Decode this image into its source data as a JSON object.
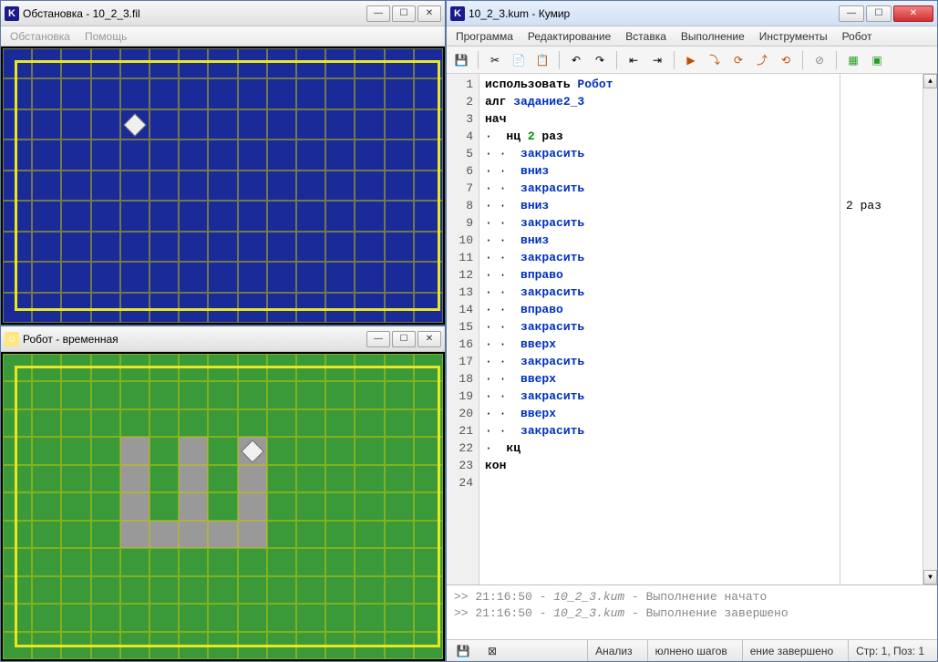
{
  "windows": {
    "env": {
      "title": "Обстановка - 10_2_3.fil",
      "menu": [
        "Обстановка",
        "Помощь"
      ],
      "icon": "K"
    },
    "robot": {
      "title": "Робот - временная",
      "icon": "☺"
    },
    "kumir": {
      "title": "10_2_3.kum - Кумир",
      "icon": "K",
      "menu": [
        "Программа",
        "Редактирование",
        "Вставка",
        "Выполнение",
        "Инструменты",
        "Робот"
      ],
      "side_output": "2 раз",
      "status": {
        "analysis": "Анализ",
        "steps": "юлнено шагов",
        "done": "ение завершено",
        "cursor": "Стр: 1, Поз: 1"
      }
    }
  },
  "code": {
    "lines": [
      {
        "n": 1,
        "indent": 0,
        "tokens": [
          [
            "kw",
            "использовать "
          ],
          [
            "exec",
            "Робот"
          ]
        ]
      },
      {
        "n": 2,
        "indent": 0,
        "tokens": [
          [
            "kw",
            "алг "
          ],
          [
            "cmd",
            "задание2_3"
          ]
        ]
      },
      {
        "n": 3,
        "indent": 0,
        "tokens": [
          [
            "kw",
            "нач"
          ]
        ]
      },
      {
        "n": 4,
        "indent": 1,
        "marker": "·",
        "tokens": [
          [
            "kw",
            "нц "
          ],
          [
            "num",
            "2"
          ],
          [
            "kw",
            " раз"
          ]
        ]
      },
      {
        "n": 5,
        "indent": 2,
        "marker": "· ·",
        "tokens": [
          [
            "cmd",
            "закрасить"
          ]
        ]
      },
      {
        "n": 6,
        "indent": 2,
        "marker": "· ·",
        "tokens": [
          [
            "cmd",
            "вниз"
          ]
        ]
      },
      {
        "n": 7,
        "indent": 2,
        "marker": "· ·",
        "tokens": [
          [
            "cmd",
            "закрасить"
          ]
        ]
      },
      {
        "n": 8,
        "indent": 2,
        "marker": "· ·",
        "tokens": [
          [
            "cmd",
            "вниз"
          ]
        ]
      },
      {
        "n": 9,
        "indent": 2,
        "marker": "· ·",
        "tokens": [
          [
            "cmd",
            "закрасить"
          ]
        ]
      },
      {
        "n": 10,
        "indent": 2,
        "marker": "· ·",
        "tokens": [
          [
            "cmd",
            "вниз"
          ]
        ]
      },
      {
        "n": 11,
        "indent": 2,
        "marker": "· ·",
        "tokens": [
          [
            "cmd",
            "закрасить"
          ]
        ]
      },
      {
        "n": 12,
        "indent": 2,
        "marker": "· ·",
        "tokens": [
          [
            "cmd",
            "вправо"
          ]
        ]
      },
      {
        "n": 13,
        "indent": 2,
        "marker": "· ·",
        "tokens": [
          [
            "cmd",
            "закрасить"
          ]
        ]
      },
      {
        "n": 14,
        "indent": 2,
        "marker": "· ·",
        "tokens": [
          [
            "cmd",
            "вправо"
          ]
        ]
      },
      {
        "n": 15,
        "indent": 2,
        "marker": "· ·",
        "tokens": [
          [
            "cmd",
            "закрасить"
          ]
        ]
      },
      {
        "n": 16,
        "indent": 2,
        "marker": "· ·",
        "tokens": [
          [
            "cmd",
            "вверх"
          ]
        ]
      },
      {
        "n": 17,
        "indent": 2,
        "marker": "· ·",
        "tokens": [
          [
            "cmd",
            "закрасить"
          ]
        ]
      },
      {
        "n": 18,
        "indent": 2,
        "marker": "· ·",
        "tokens": [
          [
            "cmd",
            "вверх"
          ]
        ]
      },
      {
        "n": 19,
        "indent": 2,
        "marker": "· ·",
        "tokens": [
          [
            "cmd",
            "закрасить"
          ]
        ]
      },
      {
        "n": 20,
        "indent": 2,
        "marker": "· ·",
        "tokens": [
          [
            "cmd",
            "вверх"
          ]
        ]
      },
      {
        "n": 21,
        "indent": 2,
        "marker": "· ·",
        "tokens": [
          [
            "cmd",
            "закрасить"
          ]
        ]
      },
      {
        "n": 22,
        "indent": 1,
        "marker": "·",
        "tokens": [
          [
            "kw",
            "кц"
          ]
        ]
      },
      {
        "n": 23,
        "indent": 0,
        "tokens": [
          [
            "kw",
            "кон"
          ]
        ]
      },
      {
        "n": 24,
        "indent": 0,
        "tokens": []
      }
    ]
  },
  "console_lines": [
    ">> 21:16:50 - 10_2_3.kum - Выполнение начато",
    ">> 21:16:50 - 10_2_3.kum - Выполнение завершено"
  ],
  "toolbar_icons": [
    {
      "name": "save-icon",
      "glyph": "💾"
    },
    {
      "name": "cut-icon",
      "glyph": "✂"
    },
    {
      "name": "copy-icon",
      "glyph": "📄"
    },
    {
      "name": "paste-icon",
      "glyph": "📋"
    },
    {
      "name": "undo-icon",
      "glyph": "↶"
    },
    {
      "name": "redo-icon",
      "glyph": "↷"
    },
    {
      "name": "outdent-icon",
      "glyph": "⇤"
    },
    {
      "name": "indent-icon",
      "glyph": "⇥"
    },
    {
      "name": "run-icon",
      "glyph": "▶"
    },
    {
      "name": "step-icon",
      "glyph": "⤵"
    },
    {
      "name": "stepover-icon",
      "glyph": "⟳"
    },
    {
      "name": "stepout-icon",
      "glyph": "⤴"
    },
    {
      "name": "trace-icon",
      "glyph": "⟲"
    },
    {
      "name": "stop-icon",
      "glyph": "⊘"
    },
    {
      "name": "grid-icon",
      "glyph": "▦"
    },
    {
      "name": "robot-icon",
      "glyph": "▣"
    }
  ],
  "env_grid": {
    "cols": 15,
    "rows": 9,
    "robot": {
      "col": 4,
      "row": 2
    }
  },
  "robot_grid": {
    "cols": 15,
    "rows": 11,
    "robot": {
      "col": 8,
      "row": 3
    },
    "painted": [
      [
        4,
        3
      ],
      [
        4,
        4
      ],
      [
        4,
        5
      ],
      [
        4,
        6
      ],
      [
        5,
        6
      ],
      [
        6,
        6
      ],
      [
        6,
        5
      ],
      [
        6,
        4
      ],
      [
        6,
        3
      ],
      [
        7,
        6
      ],
      [
        8,
        6
      ],
      [
        8,
        5
      ],
      [
        8,
        4
      ],
      [
        8,
        3
      ]
    ]
  }
}
